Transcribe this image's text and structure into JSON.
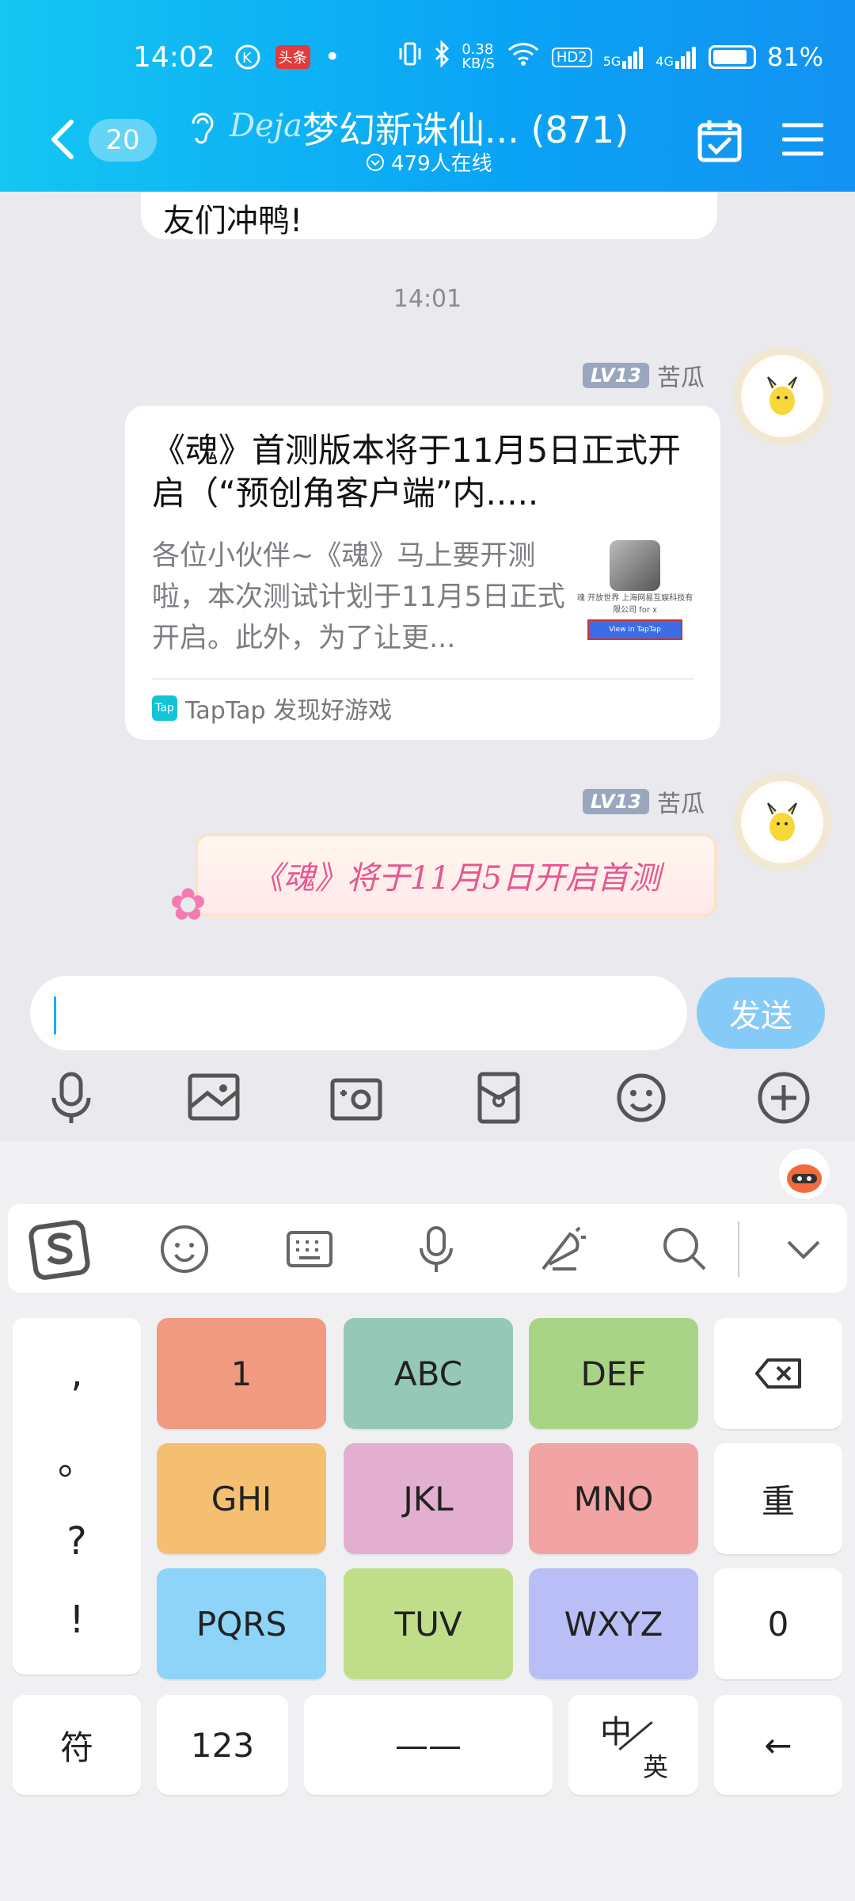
{
  "status": {
    "time": "14:02",
    "toutiao": "头条",
    "net_speed": "0.38",
    "net_unit": "KB/S",
    "hd": "HD2",
    "sig1": "5G",
    "sig2": "4G",
    "battery": "81%"
  },
  "header": {
    "unread": "20",
    "deja": "Deja",
    "title": "梦幻新诛仙... (871)",
    "online": "479人在线"
  },
  "chat": {
    "prev_text": "友们冲鸭!",
    "timestamp": "14:01",
    "sender_level": "LV13",
    "sender_name": "苦瓜",
    "card": {
      "title": "《魂》首测版本将于11月5日正式开启（“预创角客户端”内.....",
      "desc": "各位小伙伴~《魂》马上要开测啦，本次测试计划于11月5日正式开启。此外，为了让更...",
      "thumb_caption": "魂 开放世界 上海网易互娱科技有限公司 for x",
      "thumb_button": "View in TapTap",
      "source_icon": "Tap",
      "source": "TapTap 发现好游戏"
    },
    "banner_text": "《魂》将于11月5日开启首测"
  },
  "input": {
    "placeholder": "",
    "send": "发送"
  },
  "keyboard": {
    "punct": [
      ",",
      "。",
      "?",
      "!"
    ],
    "keys": [
      "1",
      "ABC",
      "DEF",
      "GHI",
      "JKL",
      "MNO",
      "PQRS",
      "TUV",
      "WXYZ"
    ],
    "repeat": "重",
    "zero": "0",
    "symbol": "符",
    "num": "123",
    "space": "——",
    "lang_zh": "中",
    "lang_en": "英",
    "enter": "←"
  },
  "colors": {
    "header": "#0aa3f5",
    "send": "#86cbf8",
    "key_1": "#f09a82",
    "key_abc": "#95c8b6",
    "key_def": "#a9d485",
    "key_ghi": "#f5bf72",
    "key_jkl": "#e2afd0",
    "key_mno": "#f2a3a3",
    "key_pqrs": "#8dd4f8",
    "key_tuv": "#c0de8a",
    "key_wxyz": "#babef6"
  }
}
